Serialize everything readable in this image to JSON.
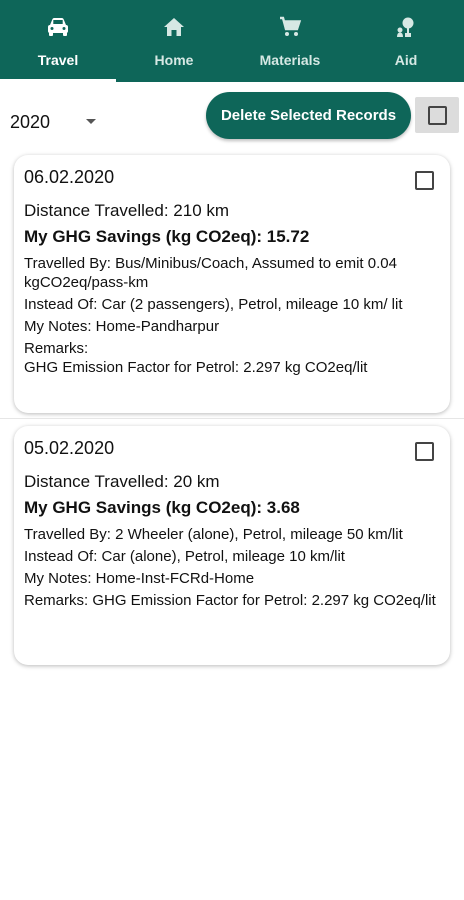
{
  "tabs": [
    {
      "label": "Travel",
      "icon": "car-icon",
      "active": true
    },
    {
      "label": "Home",
      "icon": "home-icon",
      "active": false
    },
    {
      "label": "Materials",
      "icon": "cart-icon",
      "active": false
    },
    {
      "label": "Aid",
      "icon": "aid-icon",
      "active": false
    }
  ],
  "toolbar": {
    "year": "2020",
    "delete_label": "Delete Selected Records"
  },
  "records": [
    {
      "date": "06.02.2020",
      "distance": "Distance Travelled: 210 km",
      "savings": "My GHG Savings (kg CO2eq): 15.72",
      "travelled_by": "Travelled By: Bus/Minibus/Coach, Assumed to emit 0.04 kgCO2eq/pass-km",
      "instead_of": "Instead Of: Car (2 passengers), Petrol, mileage 10 km/ lit",
      "notes": "My Notes: Home-Pandharpur",
      "remarks": "Remarks:\nGHG Emission Factor for Petrol: 2.297 kg CO2eq/lit"
    },
    {
      "date": "05.02.2020",
      "distance": "Distance Travelled: 20 km",
      "savings": "My GHG Savings (kg CO2eq): 3.68",
      "travelled_by": "Travelled By: 2 Wheeler (alone), Petrol, mileage 50 km/lit",
      "instead_of": "Instead Of: Car (alone), Petrol, mileage 10 km/lit",
      "notes": "My Notes: Home-Inst-FCRd-Home",
      "remarks": "Remarks: GHG Emission Factor for Petrol: 2.297 kg CO2eq/lit"
    }
  ],
  "colors": {
    "primary": "#0e6659",
    "tab_text": "#d6e8e4",
    "active_text": "#ffffff"
  }
}
